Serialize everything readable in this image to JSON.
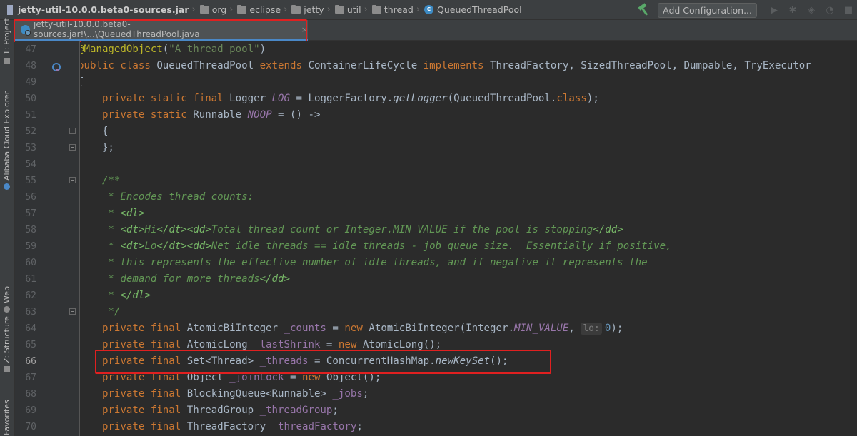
{
  "breadcrumb": {
    "jar": "jetty-util-10.0.0.beta0-sources.jar",
    "packages": [
      "org",
      "eclipse",
      "jetty",
      "util",
      "thread"
    ],
    "class_name": "QueuedThreadPool",
    "class_icon_letter": "c"
  },
  "toolbar": {
    "add_config_label": "Add Configuration...",
    "build_icon": "hammer-icon",
    "run_icon": "run-icon",
    "debug_icon": "debug-icon",
    "coverage_icon": "coverage-icon",
    "profile_icon": "profile-icon"
  },
  "left_strip": {
    "project": "1: Project",
    "cloud": "Alibaba Cloud Explorer",
    "web": "Web",
    "structure": "Z: Structure",
    "favorites": "Favorites"
  },
  "tab": {
    "label": "jetty-util-10.0.0.beta0-sources.jar!\\...\\QueuedThreadPool.java",
    "close": "×"
  },
  "colors": {
    "highlight_box": "#e02020",
    "keyword": "#cc7832",
    "annotation": "#bbb529",
    "string": "#6a8759",
    "field": "#9876aa",
    "doc_comment": "#629755",
    "editor_bg": "#2b2b2b"
  },
  "code": {
    "line_numbers": [
      "47",
      "48",
      "49",
      "50",
      "51",
      "52",
      "53",
      "54",
      "55",
      "56",
      "57",
      "58",
      "59",
      "60",
      "61",
      "62",
      "63",
      "64",
      "65",
      "66",
      "67",
      "68",
      "69",
      "70"
    ],
    "current_line": "66",
    "hint_param": "lo:",
    "l64_value": "0"
  }
}
